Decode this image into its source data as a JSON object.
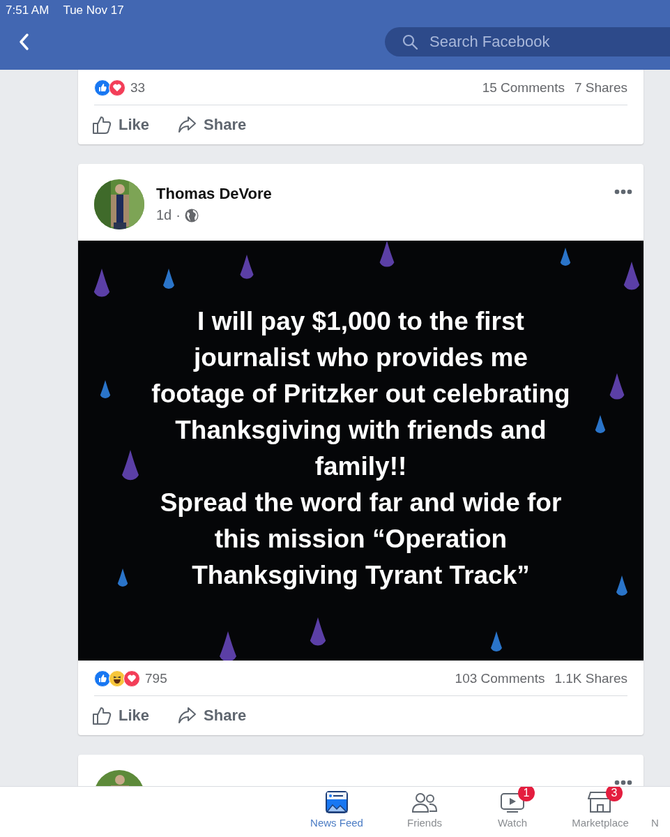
{
  "status_bar": {
    "time": "7:51 AM",
    "date": "Tue Nov 17"
  },
  "header": {
    "search": {
      "placeholder": "Search Facebook"
    }
  },
  "posts": [
    {
      "reactions": [
        {
          "kind": "like"
        },
        {
          "kind": "love"
        }
      ],
      "reaction_count": "33",
      "comments": "15 Comments",
      "shares": "7 Shares",
      "actions": [
        {
          "kind": "like",
          "label": "Like"
        },
        {
          "kind": "share",
          "label": "Share"
        }
      ]
    },
    {
      "author": "Thomas DeVore",
      "time": "1d",
      "separator": "·",
      "text": "I will pay $1,000 to the first\njournalist who provides me\nfootage of Pritzker out celebrating\nThanksgiving with friends and\nfamily!!\nSpread the word far and wide for\nthis mission “Operation\nThanksgiving Tyrant Track”",
      "reactions": [
        {
          "kind": "like"
        },
        {
          "kind": "haha"
        },
        {
          "kind": "love"
        }
      ],
      "reaction_count": "795",
      "comments": "103 Comments",
      "shares": "1.1K Shares",
      "actions": [
        {
          "kind": "like",
          "label": "Like"
        },
        {
          "kind": "share",
          "label": "Share"
        }
      ]
    }
  ],
  "tab_bar": [
    {
      "kind": "feed",
      "label": "News Feed",
      "selected": true
    },
    {
      "kind": "friends",
      "label": "Friends",
      "selected": false
    },
    {
      "kind": "watch",
      "label": "Watch",
      "selected": false,
      "badge": "1"
    },
    {
      "kind": "market",
      "label": "Marketplace",
      "selected": false,
      "badge": "3"
    },
    {
      "kind": "cut",
      "label": "N",
      "selected": false
    }
  ]
}
